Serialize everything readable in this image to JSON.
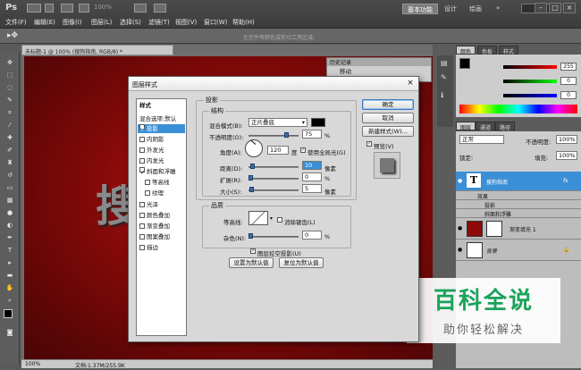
{
  "app": {
    "logo": "Ps",
    "zoom": "100%"
  },
  "menu": [
    "文件(F)",
    "编辑(E)",
    "图像(I)",
    "图层(L)",
    "选择(S)",
    "滤镜(T)",
    "视图(V)",
    "窗口(W)",
    "帮助(H)"
  ],
  "workspace": {
    "active": "基本功能",
    "others": [
      "设计",
      "绘画",
      "»"
    ]
  },
  "options_bar": {
    "hint": "在控件等颜色或剪切工具区域。"
  },
  "document": {
    "tab_title": "未标题-1 @ 100% (搜狗指南, RGB/8) *",
    "canvas_text": "搜",
    "status_zoom": "100%",
    "status_doc": "文档:1.37M/255.9K"
  },
  "history_panel": {
    "tab": "历史记录",
    "items": [
      "移动",
      "移动"
    ]
  },
  "color_panel": {
    "tabs": [
      "颜色",
      "色板",
      "样式"
    ],
    "values": [
      "255",
      "0",
      "0"
    ]
  },
  "layers_panel": {
    "tabs": [
      "图层",
      "通道",
      "路径"
    ],
    "blend_mode": "正常",
    "opacity_label": "不透明度:",
    "opacity": "100%",
    "lock_label": "锁定:",
    "fill_label": "填充:",
    "fill": "100%",
    "layers": [
      {
        "name": "搜狗指南",
        "type": "T",
        "fx": "fx"
      },
      {
        "name": "效果",
        "sub": true
      },
      {
        "name": "投影",
        "sub": true
      },
      {
        "name": "斜面和浮雕",
        "sub": true
      },
      {
        "name": "渐变填充 1"
      },
      {
        "name": "背景"
      }
    ]
  },
  "dialog": {
    "title": "图层样式",
    "style_list_header": "样式",
    "style_list_blend": "混合选项:默认",
    "styles": [
      "投影",
      "内阴影",
      "外发光",
      "内发光",
      "斜面和浮雕",
      "等高线",
      "纹理",
      "光泽",
      "颜色叠加",
      "渐变叠加",
      "图案叠加",
      "描边"
    ],
    "section_title": "投影",
    "structure_title": "结构",
    "blend_mode_label": "混合模式(B):",
    "blend_mode_value": "正片叠底",
    "opacity_label": "不透明度(O):",
    "opacity_value": "75",
    "angle_label": "角度(A):",
    "angle_value": "120",
    "angle_unit": "度",
    "global_light_label": "使用全局光(G)",
    "distance_label": "距离(D):",
    "distance_value": "10",
    "spread_label": "扩展(R):",
    "spread_value": "0",
    "size_label": "大小(S):",
    "size_value": "5",
    "unit_px": "像素",
    "unit_pct": "%",
    "quality_title": "品质",
    "contour_label": "等高线:",
    "antialias_label": "消除锯齿(L)",
    "noise_label": "杂色(N):",
    "noise_value": "0",
    "knockout_label": "图层挖空投影(U)",
    "make_default": "设置为默认值",
    "reset_default": "复位为默认值",
    "ok": "确定",
    "cancel": "取消",
    "new_style": "新建样式(W)...",
    "preview": "预览(V)"
  },
  "watermark": {
    "title": "百科全说",
    "subtitle": "助你轻松解决"
  },
  "colors": {
    "accent": "#3b8fd6",
    "canvas": "#8e0a0a",
    "watermark": "#1aa35a"
  }
}
